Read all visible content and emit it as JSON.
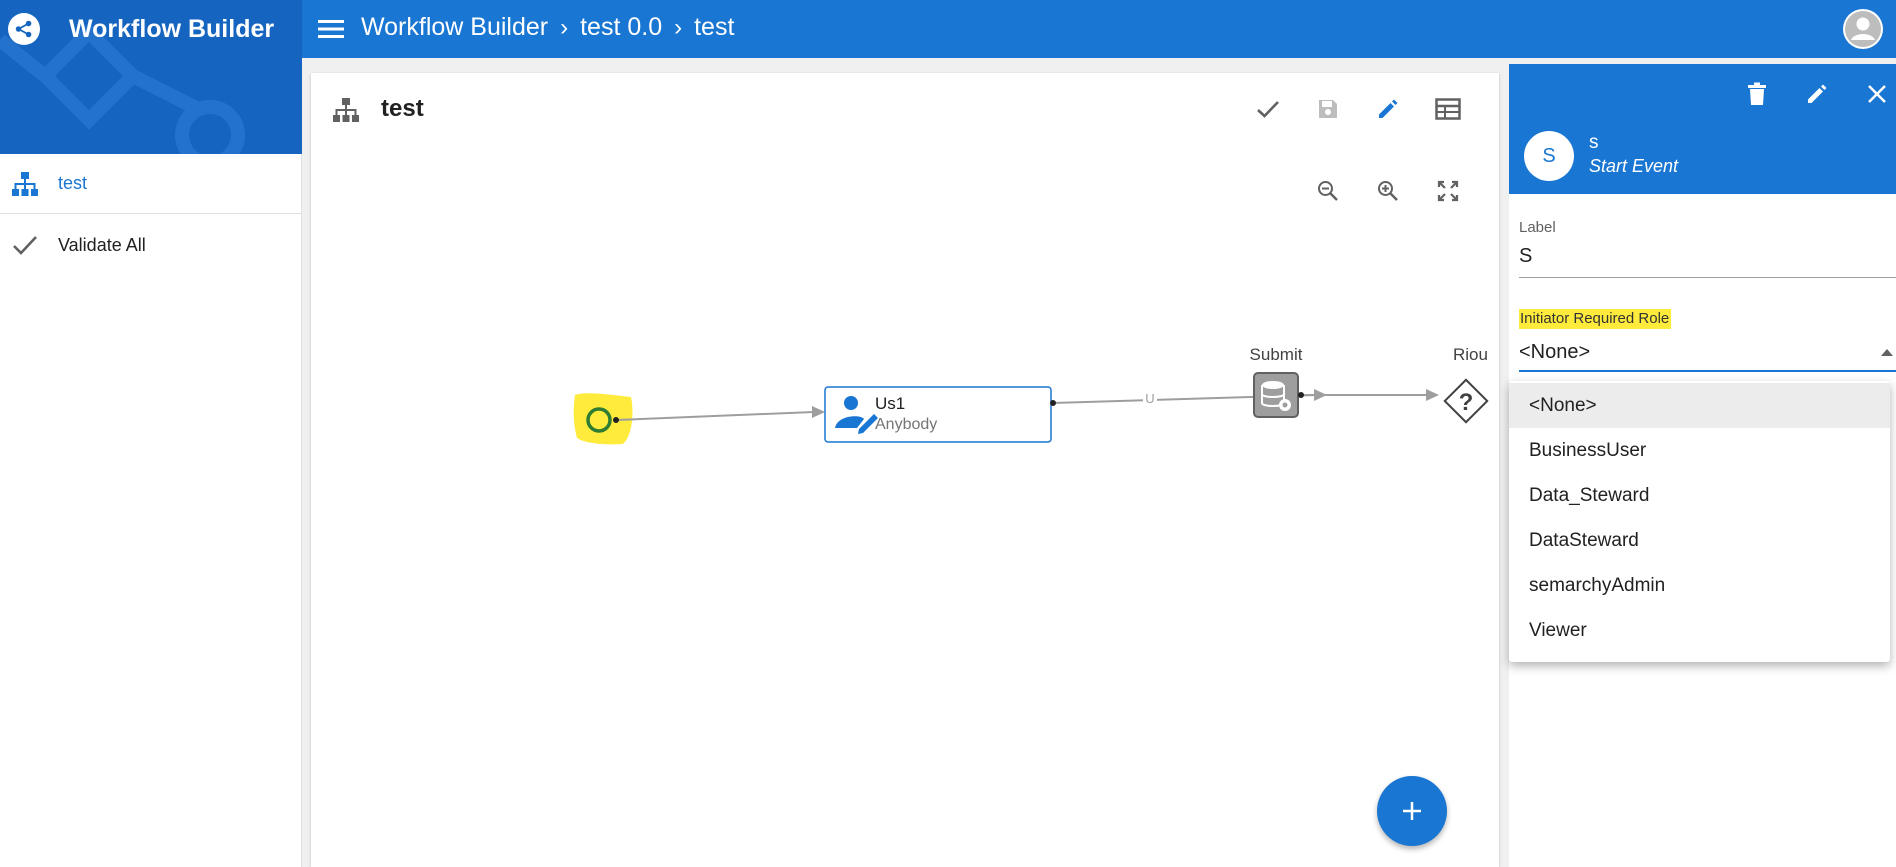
{
  "app": {
    "title": "Workflow Builder",
    "breadcrumb": [
      "Workflow Builder",
      "test 0.0",
      "test"
    ]
  },
  "icons": {
    "brand": "share-network-icon",
    "menu": "hamburger-menu-icon",
    "account": "account-circle-icon"
  },
  "sidebar": {
    "items": [
      {
        "label": "test",
        "icon": "workflow-tree-icon"
      },
      {
        "label": "Validate All",
        "icon": "check-icon"
      }
    ]
  },
  "canvas": {
    "title": "test",
    "toolbar": [
      "validate-check-icon",
      "save-icon",
      "edit-pencil-icon",
      "table-icon"
    ],
    "zoom_tools": [
      "zoom-out-icon",
      "zoom-in-icon",
      "fit-to-screen-icon"
    ],
    "nodes": {
      "user_task": {
        "title": "Us1",
        "subtitle": "Anybody"
      },
      "submit": {
        "label": "Submit"
      },
      "route": {
        "label": "Riou"
      },
      "route_glyph": "?",
      "transition_label": "U"
    },
    "fab_label": "+"
  },
  "panel": {
    "element_initial": "S",
    "element_name": "s",
    "element_type": "Start Event",
    "actions": [
      "delete-icon",
      "edit-icon",
      "close-icon"
    ],
    "label_field": {
      "label": "Label",
      "value": "S"
    },
    "role_field": {
      "label": "Initiator Required Role",
      "value": "<None>"
    }
  },
  "dropdown": {
    "options": [
      "<None>",
      "BusinessUser",
      "Data_Steward",
      "DataSteward",
      "semarchyAdmin",
      "Viewer"
    ],
    "selected_index": 0
  },
  "colors": {
    "primary": "#1976d2",
    "brand_dark": "#1565c0",
    "highlight": "#ffeb3b",
    "start_event_ring": "#2e7d32",
    "connector": "#9e9e9e"
  }
}
